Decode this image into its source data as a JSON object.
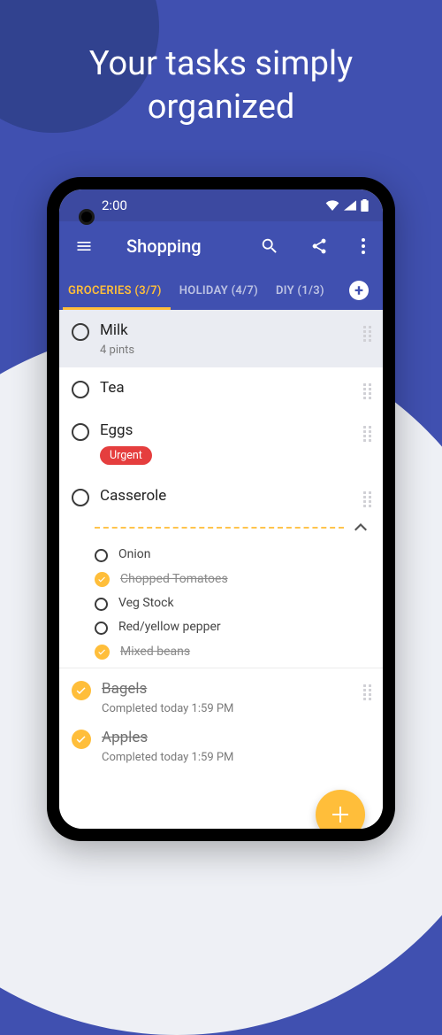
{
  "headline": "Your tasks simply organized",
  "statusbar": {
    "time": "2:00"
  },
  "appbar": {
    "title": "Shopping"
  },
  "tabs": [
    {
      "label": "GROCERIES (3/7)",
      "active": true
    },
    {
      "label": "HOLIDAY (4/7)",
      "active": false
    },
    {
      "label": "DIY (1/3)",
      "active": false
    }
  ],
  "items": [
    {
      "title": "Milk",
      "subtitle": "4 pints",
      "selected": true
    },
    {
      "title": "Tea"
    },
    {
      "title": "Eggs",
      "tag": "Urgent"
    },
    {
      "title": "Casserole"
    }
  ],
  "subitems": [
    {
      "title": "Onion",
      "done": false
    },
    {
      "title": "Chopped Tomatoes",
      "done": true
    },
    {
      "title": "Veg Stock",
      "done": false
    },
    {
      "title": "Red/yellow pepper",
      "done": false
    },
    {
      "title": "Mixed beans",
      "done": true
    }
  ],
  "completed": [
    {
      "title": "Bagels",
      "subtitle": "Completed today 1:59 PM"
    },
    {
      "title": "Apples",
      "subtitle": "Completed today 1:59 PM"
    }
  ]
}
